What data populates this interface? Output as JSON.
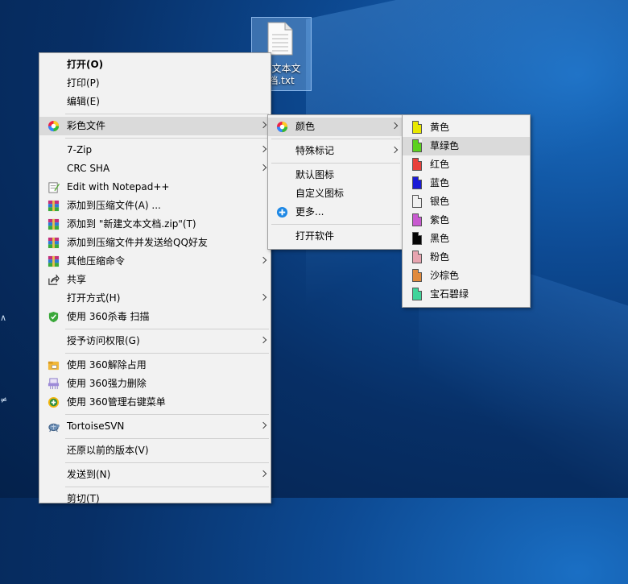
{
  "desktop": {
    "file_icon_label": "新建文本文档.txt",
    "file_icon_label_visible": "建文本文\n档.txt"
  },
  "main_menu": {
    "items": [
      {
        "label": "打开(O)"
      },
      {
        "label": "打印(P)"
      },
      {
        "label": "编辑(E)"
      },
      {
        "label": "彩色文件"
      },
      {
        "label": "7-Zip"
      },
      {
        "label": "CRC SHA"
      },
      {
        "label": "Edit with Notepad++"
      },
      {
        "label": "添加到压缩文件(A) ..."
      },
      {
        "label": "添加到 \"新建文本文档.zip\"(T)"
      },
      {
        "label": "添加到压缩文件并发送给QQ好友"
      },
      {
        "label": "其他压缩命令"
      },
      {
        "label": "共享"
      },
      {
        "label": "打开方式(H)"
      },
      {
        "label": "使用 360杀毒 扫描"
      },
      {
        "label": "授予访问权限(G)"
      },
      {
        "label": "使用 360解除占用"
      },
      {
        "label": "使用 360强力删除"
      },
      {
        "label": "使用 360管理右键菜单"
      },
      {
        "label": "TortoiseSVN"
      },
      {
        "label": "还原以前的版本(V)"
      },
      {
        "label": "发送到(N)"
      },
      {
        "label": "剪切(T)"
      }
    ]
  },
  "color_menu": {
    "items": [
      {
        "label": "颜色"
      },
      {
        "label": "特殊标记"
      },
      {
        "label": "默认图标"
      },
      {
        "label": "自定义图标"
      },
      {
        "label": "更多..."
      },
      {
        "label": "打开软件"
      }
    ]
  },
  "hue_menu": {
    "items": [
      {
        "label": "黄色",
        "color": "#e8e800"
      },
      {
        "label": "草绿色",
        "color": "#5bd11e"
      },
      {
        "label": "红色",
        "color": "#e8403a"
      },
      {
        "label": "蓝色",
        "color": "#1a1ad6"
      },
      {
        "label": "银色",
        "color": "#f0f0f0"
      },
      {
        "label": "紫色",
        "color": "#c85ad0"
      },
      {
        "label": "黑色",
        "color": "#050505"
      },
      {
        "label": "粉色",
        "color": "#e7a4b0"
      },
      {
        "label": "沙棕色",
        "color": "#e08a3c"
      },
      {
        "label": "宝石碧绿",
        "color": "#3fd49a"
      }
    ]
  },
  "icons": {
    "colorfile": "color-wheel-icon",
    "notepad": "notepad-icon",
    "archive": "winrar-icon",
    "share": "share-icon",
    "shield": "360-shield-icon",
    "svn": "tortoise-icon",
    "more": "plus-circle-icon"
  }
}
